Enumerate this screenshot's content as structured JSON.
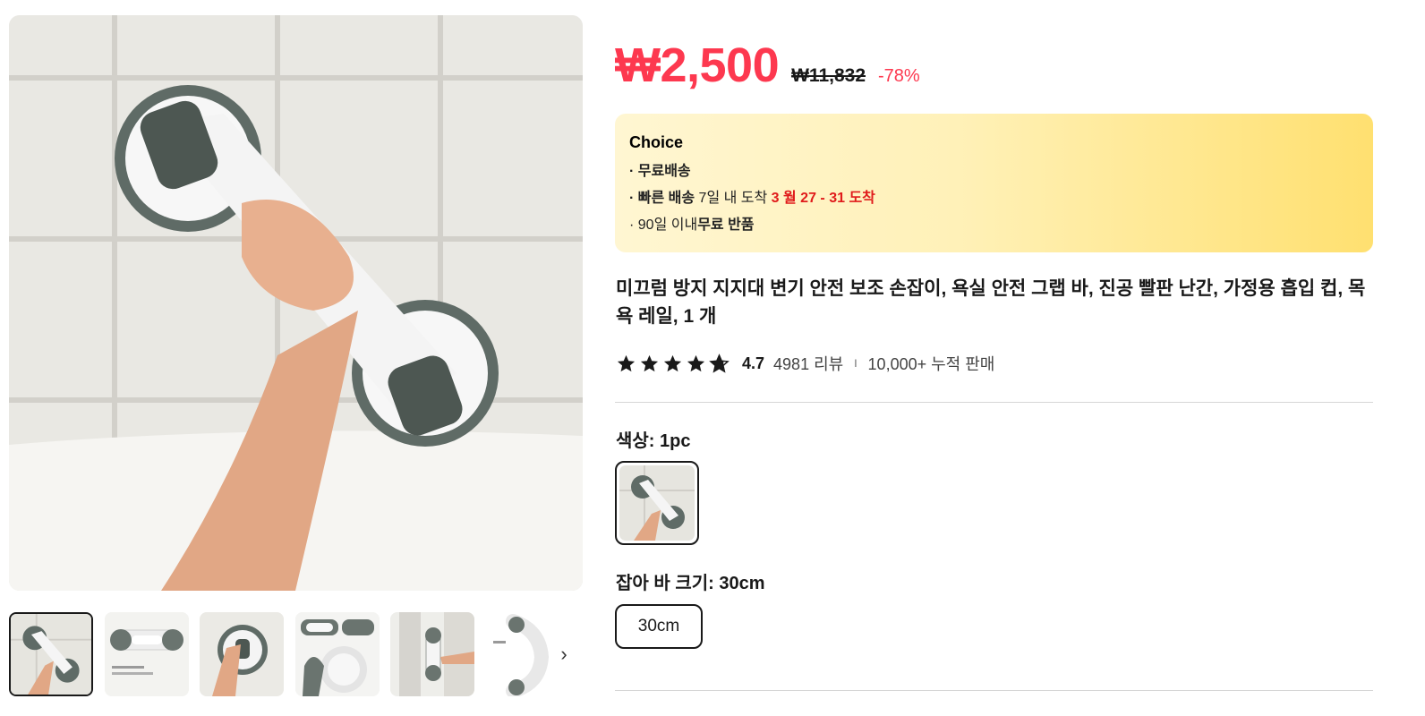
{
  "price": {
    "current": "₩2,500",
    "original": "₩11,832",
    "discount": "-78%"
  },
  "choice": {
    "title": "Choice",
    "line1_bold": "· 무료배송",
    "line2_bold": "· 빠른 배송",
    "line2_text": " 7일 내 도착 ",
    "line2_red": "3 월 27 - 31 도착",
    "line3_text": "· 90일 이내",
    "line3_bold": "무료 반품"
  },
  "product": {
    "title": "미끄럼 방지 지지대 변기 안전 보조 손잡이, 욕실 안전 그랩 바, 진공 빨판 난간, 가정용 흡입 컵, 목욕 레일, 1 개"
  },
  "rating": {
    "score": "4.7",
    "stars": 4.7,
    "reviews": "4981 리뷰",
    "separator": "I",
    "sold": "10,000+ 누적 판매"
  },
  "options": {
    "color_label": "색상: 1pc",
    "size_label": "잡아 바 크기: 30cm",
    "size_value": "30cm"
  },
  "icons": {
    "thumb_next": "chevron-right-icon",
    "star": "star-icon"
  },
  "colors": {
    "price_red": "#fd384f",
    "delivery_red": "#e01b1b",
    "choice_gradient_end": "#ffe070"
  }
}
